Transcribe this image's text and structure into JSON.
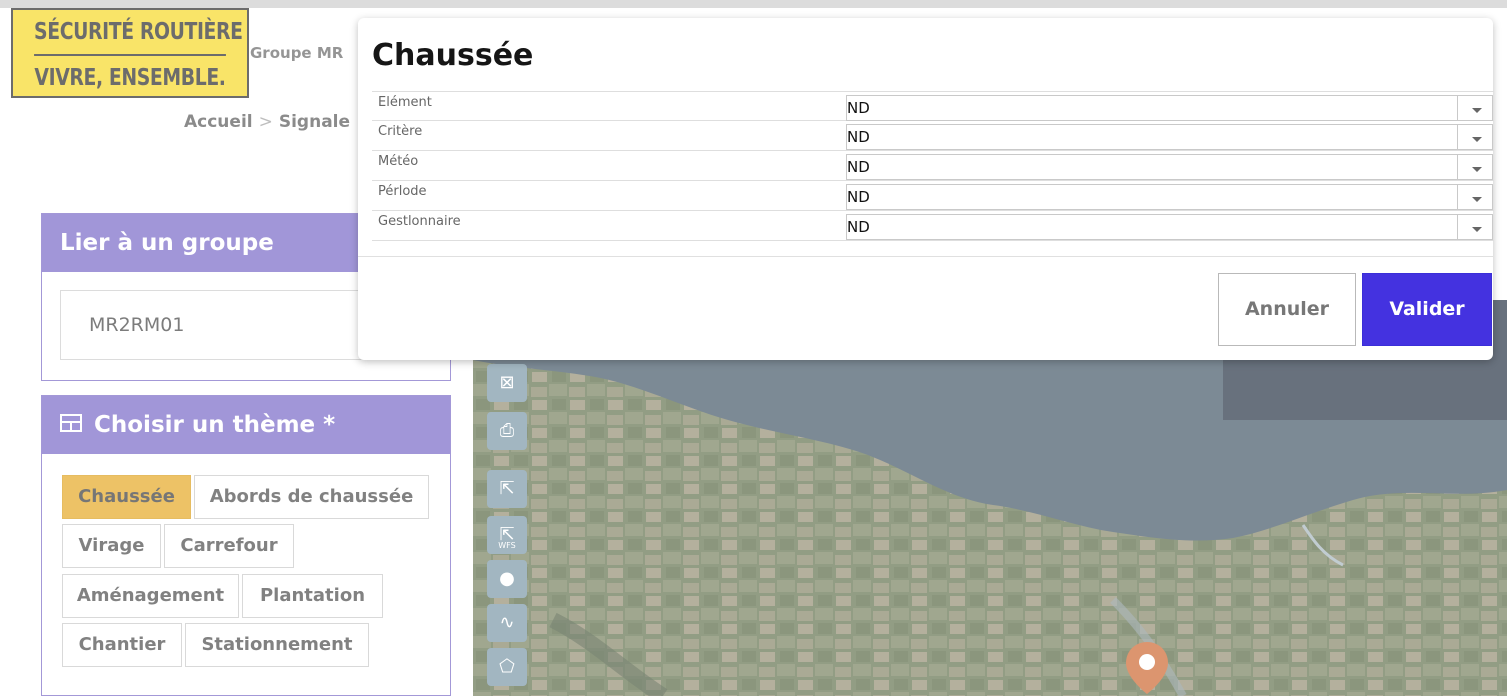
{
  "header": {
    "logo_line1": "SÉCURITÉ ROUTIÈRE",
    "logo_line2": "VIVRE, ENSEMBLE.",
    "group_label": "Groupe MR"
  },
  "breadcrumb": {
    "home": "Accueil",
    "separator": ">",
    "current": "Signale"
  },
  "group_panel": {
    "title": "Lier à un groupe",
    "value": "MR2RM01"
  },
  "theme_panel": {
    "title": "Choisir un thème  *",
    "icon": "grid-table-icon",
    "chips": [
      "Chaussée",
      "Abords de chaussée",
      "Virage",
      "Carrefour",
      "Aménagement",
      "Plantation",
      "Chantier",
      "Stationnement"
    ],
    "selected": "Chaussée",
    "selected_color": "#e3a010"
  },
  "map": {
    "tools": [
      "zoom-extent-icon",
      "export-icon",
      "select-icon",
      "wfs-select-icon",
      "point-icon",
      "line-icon",
      "polygon-icon"
    ],
    "wfs_label": "WFS",
    "pin_color": "#c85a1e"
  },
  "modal": {
    "title": "Chaussée",
    "fields": [
      {
        "label": "Elément",
        "value": "ND"
      },
      {
        "label": "Critère",
        "value": "ND"
      },
      {
        "label": "Météo",
        "value": "ND"
      },
      {
        "label": "Pérlode",
        "value": "ND"
      },
      {
        "label": "Gestlonnaire",
        "value": "ND"
      }
    ],
    "cancel_label": "Annuler",
    "submit_label": "Valider",
    "accent_color": "#4432e0"
  }
}
